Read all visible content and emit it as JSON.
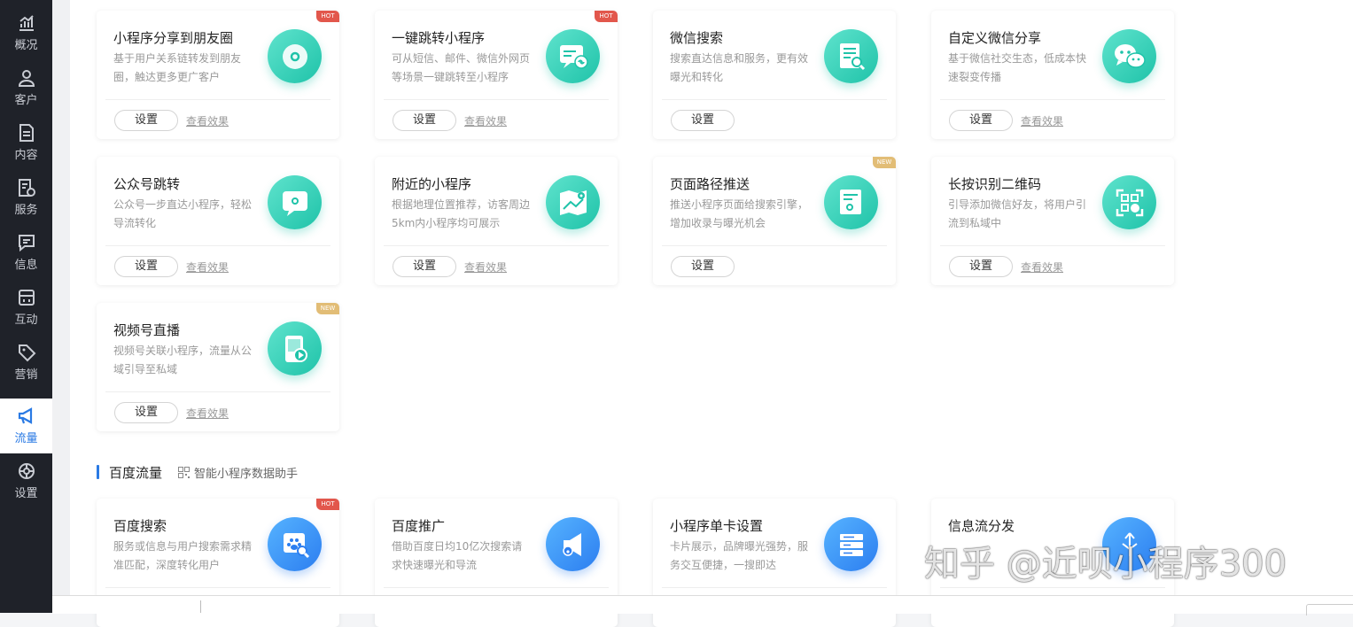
{
  "sidebar": {
    "items": [
      {
        "label": "概况",
        "icon": "chart-bar-icon"
      },
      {
        "label": "客户",
        "icon": "user-icon"
      },
      {
        "label": "内容",
        "icon": "document-icon"
      },
      {
        "label": "服务",
        "icon": "service-icon"
      },
      {
        "label": "信息",
        "icon": "message-icon"
      },
      {
        "label": "互动",
        "icon": "interact-icon"
      },
      {
        "label": "营销",
        "icon": "tag-icon"
      },
      {
        "label": "流量",
        "icon": "megaphone-icon"
      },
      {
        "label": "设置",
        "icon": "gear-icon"
      }
    ],
    "active": "流量"
  },
  "cards": [
    {
      "title": "小程序分享到朋友圈",
      "desc": "基于用户关系链转发到朋友圈，触达更多更广客户",
      "badge": "HOT",
      "icon": "moments-share-icon",
      "btn": "设置",
      "link": "查看效果"
    },
    {
      "title": "一键跳转小程序",
      "desc": "可从短信、邮件、微信外网页等场景一键跳转至小程序",
      "badge": "HOT",
      "icon": "jump-link-icon",
      "btn": "设置",
      "link": "查看效果"
    },
    {
      "title": "微信搜索",
      "desc": "搜索直达信息和服务，更有效曝光和转化",
      "badge": "",
      "icon": "search-doc-icon",
      "btn": "设置",
      "link": ""
    },
    {
      "title": "自定义微信分享",
      "desc": "基于微信社交生态，低成本快速裂变传播",
      "badge": "",
      "icon": "wechat-icon",
      "btn": "设置",
      "link": "查看效果"
    },
    {
      "title": "公众号跳转",
      "desc": "公众号一步直达小程序，轻松导流转化",
      "badge": "",
      "icon": "official-account-icon",
      "btn": "设置",
      "link": "查看效果"
    },
    {
      "title": "附近的小程序",
      "desc": "根据地理位置推荐，访客周边5km内小程序均可展示",
      "badge": "",
      "icon": "map-pin-icon",
      "btn": "设置",
      "link": "查看效果"
    },
    {
      "title": "页面路径推送",
      "desc": "推送小程序页面给搜索引擎，增加收录与曝光机会",
      "badge": "NEW",
      "icon": "page-push-icon",
      "btn": "设置",
      "link": ""
    },
    {
      "title": "长按识别二维码",
      "desc": "引导添加微信好友，将用户引流到私域中",
      "badge": "",
      "icon": "qrcode-icon",
      "btn": "设置",
      "link": "查看效果"
    },
    {
      "title": "视频号直播",
      "desc": "视频号关联小程序，流量从公域引导至私域",
      "badge": "NEW",
      "icon": "video-live-icon",
      "btn": "设置",
      "link": "查看效果"
    }
  ],
  "baidu_section": {
    "title": "百度流量",
    "subtitle": "智能小程序数据助手"
  },
  "baidu_cards": [
    {
      "title": "百度搜索",
      "desc": "服务或信息与用户搜索需求精准匹配，深度转化用户",
      "badge": "HOT",
      "icon": "baidu-search-icon"
    },
    {
      "title": "百度推广",
      "desc": "借助百度日均10亿次搜索请求快速曝光和导流",
      "badge": "",
      "icon": "baidu-promote-icon"
    },
    {
      "title": "小程序单卡设置",
      "desc": "卡片展示，品牌曝光强势，服务交互便捷，一搜即达",
      "badge": "",
      "icon": "card-list-icon"
    },
    {
      "title": "信息流分发",
      "desc": "",
      "badge": "",
      "icon": "feed-distribute-icon"
    }
  ],
  "watermark": "知乎 @近呗小程序300",
  "colors": {
    "accent": "#2a7ae4",
    "teal": "#1fc3a9",
    "blue": "#2c7ef0",
    "hot": "#e2574c",
    "new": "#e2bd76",
    "sidebar": "#1f2229"
  }
}
